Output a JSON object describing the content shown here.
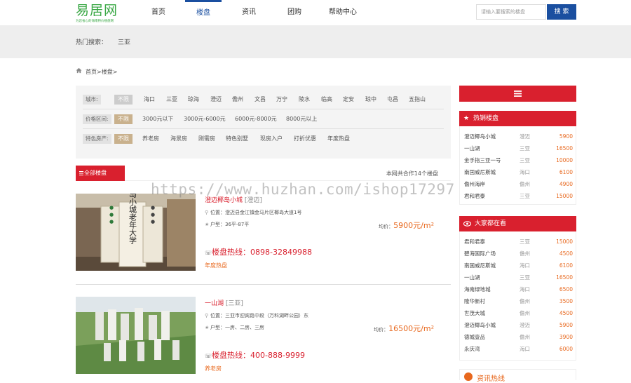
{
  "header": {
    "logo": {
      "name": "易居网",
      "tagline": "为您省心的海南特价楼盘网"
    },
    "nav": [
      {
        "label": "首页"
      },
      {
        "label": "楼盘"
      },
      {
        "label": "资讯"
      },
      {
        "label": "团购"
      },
      {
        "label": "帮助中心"
      }
    ],
    "search": {
      "placeholder": "请输入要搜索的楼盘",
      "button": "搜 索"
    }
  },
  "hot": {
    "label": "热门搜索：",
    "keyword": "三亚"
  },
  "breadcrumb": "首页>楼盘>",
  "filters": {
    "city": {
      "label": "城市:",
      "options": [
        "不限",
        "海口",
        "三亚",
        "琼海",
        "澄迈",
        "儋州",
        "文昌",
        "万宁",
        "陵水",
        "临高",
        "定安",
        "琼中",
        "屯昌",
        "五指山"
      ]
    },
    "price": {
      "label": "价格区间:",
      "options": [
        "不限",
        "3000元以下",
        "3000元-6000元",
        "6000元-8000元",
        "8000元以上"
      ]
    },
    "feature": {
      "label": "特色房产:",
      "options": [
        "不限",
        "养老房",
        "海景房",
        "刚需房",
        "特色别墅",
        "现房入户",
        "打折优惠",
        "年度热盘"
      ]
    }
  },
  "tabs": {
    "all": "全部楼盘",
    "count": "本网共合作14个楼盘"
  },
  "listings": [
    {
      "name": "澄迈椰岛小城",
      "area": "[澄迈]",
      "address_label": "位置：",
      "address": "澄迈县金江镇金马片区椰岛大道1号",
      "type_label": "户型：",
      "types": "36平-87平",
      "price_label": "均价：",
      "price": "5900元/m²",
      "phone_label": "楼盘热线：",
      "phone": "0898-32849988",
      "tag": "年度热盘",
      "sign": "椰岛小城老年大学"
    },
    {
      "name": "一山湖",
      "area": "[三亚]",
      "address_label": "位置：",
      "address": "三亚市迎宾路中段（万科湖畔公园）东",
      "type_label": "户型：",
      "types": "一房、二房、三房",
      "price_label": "均价：",
      "price": "16500元/m²",
      "phone_label": "楼盘热线：",
      "phone": "400-888-9999",
      "tag": "养老房"
    }
  ],
  "sidebar": {
    "hot": {
      "title": "热销楼盘",
      "rows": [
        {
          "name": "澄迈椰岛小城",
          "area": "澄迈",
          "price": "5900"
        },
        {
          "name": "一山湖",
          "area": "三亚",
          "price": "16500"
        },
        {
          "name": "金手指三亚一号",
          "area": "三亚",
          "price": "10000"
        },
        {
          "name": "南国威尼斯城",
          "area": "海口",
          "price": "6100"
        },
        {
          "name": "儋州海岸",
          "area": "儋州",
          "price": "4900"
        },
        {
          "name": "君和君泰",
          "area": "三亚",
          "price": "15000"
        }
      ]
    },
    "popular": {
      "title": "大家都在看",
      "rows": [
        {
          "name": "君和君泰",
          "area": "三亚",
          "price": "15000"
        },
        {
          "name": "碧海国际广场",
          "area": "儋州",
          "price": "4500"
        },
        {
          "name": "南国威尼斯城",
          "area": "海口",
          "price": "6100"
        },
        {
          "name": "一山湖",
          "area": "三亚",
          "price": "16500"
        },
        {
          "name": "海南绿地城",
          "area": "海口",
          "price": "6500"
        },
        {
          "name": "隆华新村",
          "area": "儋州",
          "price": "3500"
        },
        {
          "name": "世茂大城",
          "area": "儋州",
          "price": "4500"
        },
        {
          "name": "澄迈椰岛小城",
          "area": "澄迈",
          "price": "5900"
        },
        {
          "name": "德城壹品",
          "area": "儋州",
          "price": "3900"
        },
        {
          "name": "永庆湾",
          "area": "海口",
          "price": "6000"
        }
      ]
    },
    "news_title": "资讯热线"
  },
  "watermark": "https://www.huzhan.com/ishop17297",
  "colors": {
    "brand_green": "#3aa845",
    "nav_blue": "#1a4fa0",
    "accent_red": "#d9202e",
    "price_orange": "#e8681e",
    "filter_gold": "#c9b18d"
  },
  "icons": [
    "home-icon",
    "menu-icon",
    "star-icon",
    "eye-icon",
    "location-icon",
    "phone-icon"
  ]
}
